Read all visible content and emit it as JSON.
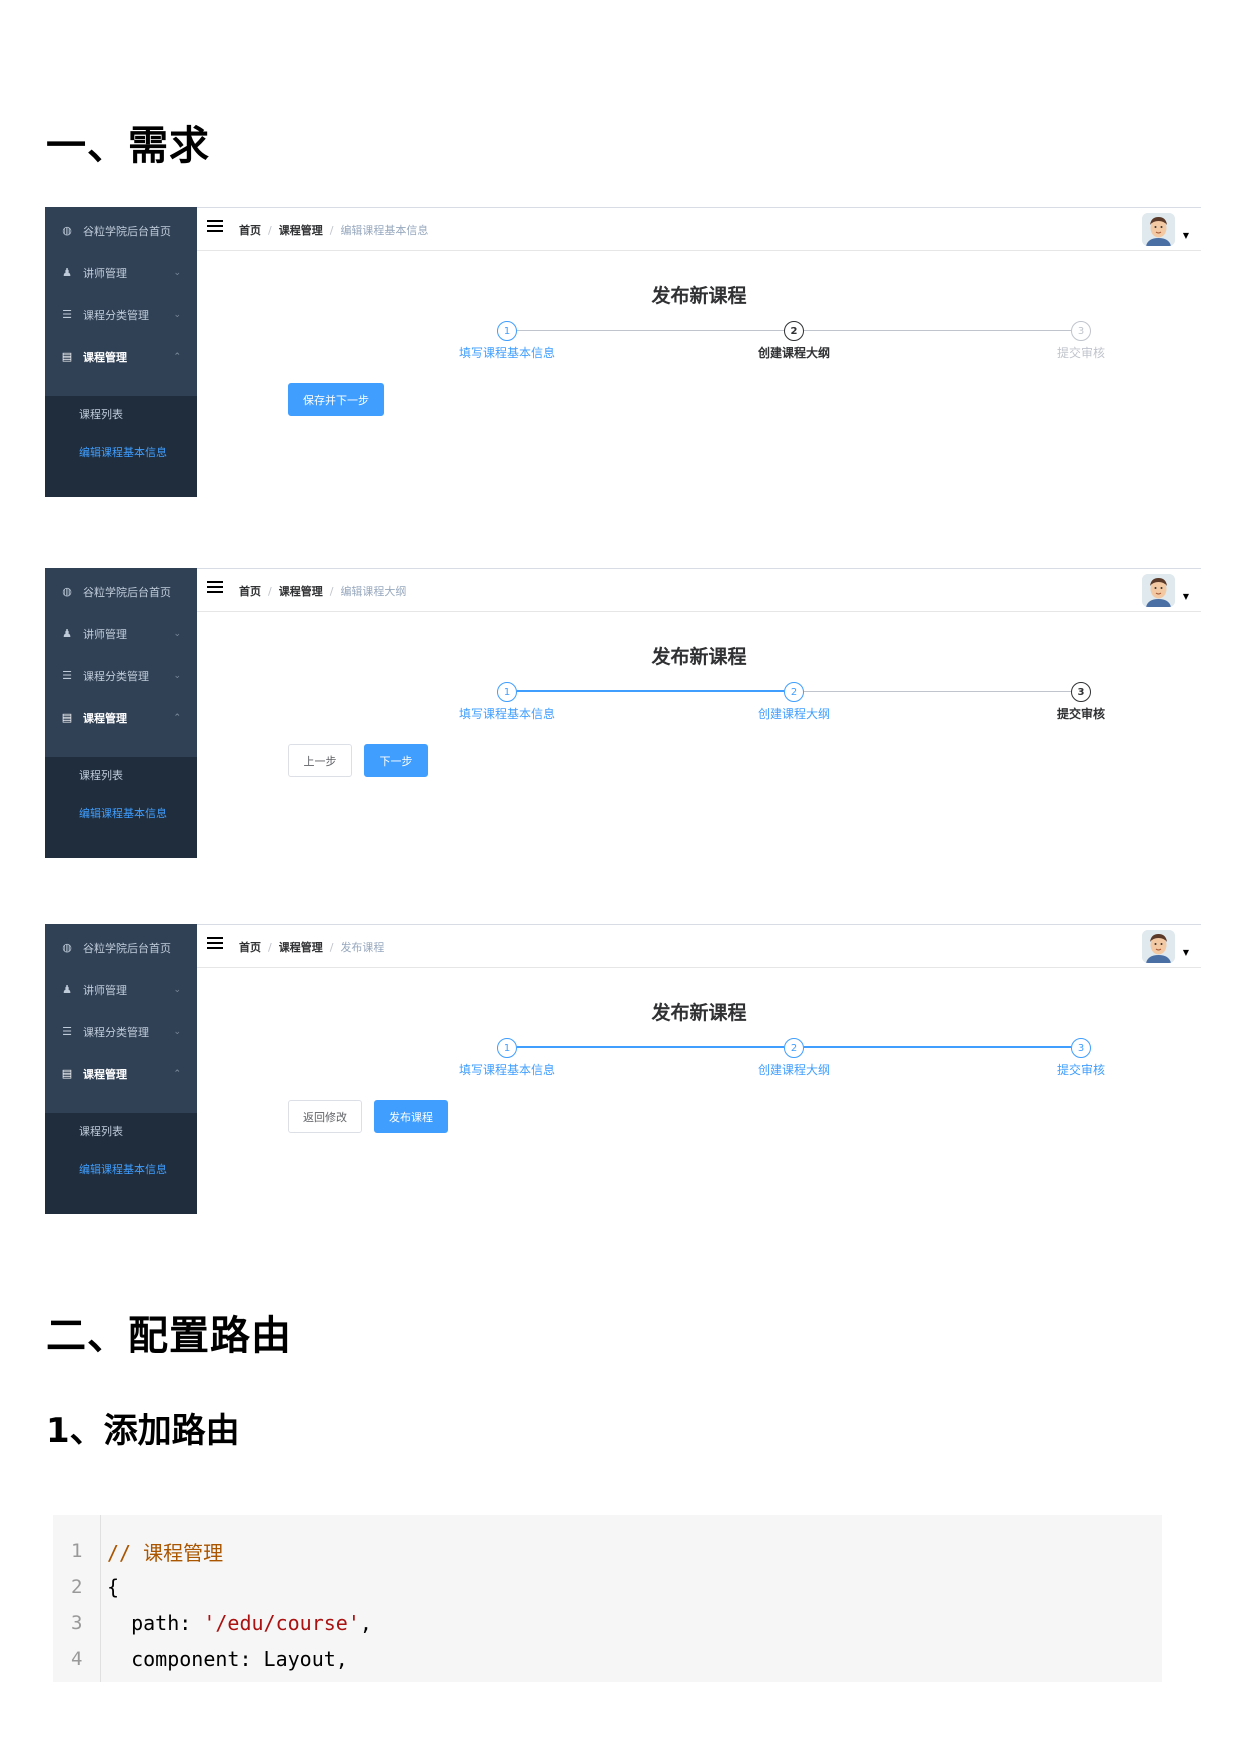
{
  "section1_heading": "一、需求",
  "section2_heading": "二、配置路由",
  "section3_heading": "1、添加路由",
  "sidebar": {
    "items": [
      {
        "label": "谷粒学院后台首页",
        "icon": "dashboard-icon",
        "arrow": ""
      },
      {
        "label": "讲师管理",
        "icon": "user-icon",
        "arrow": "⌄"
      },
      {
        "label": "课程分类管理",
        "icon": "list-icon",
        "arrow": "⌄"
      },
      {
        "label": "课程管理",
        "icon": "form-icon",
        "arrow": "⌃"
      }
    ],
    "sub_items": [
      "课程列表",
      "编辑课程基本信息"
    ]
  },
  "screens": [
    {
      "breadcrumb": [
        "首页",
        "课程管理",
        "编辑课程基本信息"
      ],
      "title": "发布新课程",
      "steps": [
        {
          "num": "1",
          "label": "填写课程基本信息",
          "state": "done"
        },
        {
          "num": "2",
          "label": "创建课程大纲",
          "state": "process"
        },
        {
          "num": "3",
          "label": "提交审核",
          "state": "wait"
        }
      ],
      "buttons": [
        {
          "label": "保存并下一步",
          "type": "primary"
        }
      ]
    },
    {
      "breadcrumb": [
        "首页",
        "课程管理",
        "编辑课程大纲"
      ],
      "title": "发布新课程",
      "steps": [
        {
          "num": "1",
          "label": "填写课程基本信息",
          "state": "done"
        },
        {
          "num": "2",
          "label": "创建课程大纲",
          "state": "done"
        },
        {
          "num": "3",
          "label": "提交审核",
          "state": "process"
        }
      ],
      "buttons": [
        {
          "label": "上一步",
          "type": "default"
        },
        {
          "label": "下一步",
          "type": "primary"
        }
      ]
    },
    {
      "breadcrumb": [
        "首页",
        "课程管理",
        "发布课程"
      ],
      "title": "发布新课程",
      "steps": [
        {
          "num": "1",
          "label": "填写课程基本信息",
          "state": "done"
        },
        {
          "num": "2",
          "label": "创建课程大纲",
          "state": "done"
        },
        {
          "num": "3",
          "label": "提交审核",
          "state": "done"
        }
      ],
      "buttons": [
        {
          "label": "返回修改",
          "type": "default"
        },
        {
          "label": "发布课程",
          "type": "primary"
        }
      ]
    }
  ],
  "code": {
    "lines": [
      {
        "num": "1",
        "parts": [
          {
            "t": "// 课程管理",
            "c": "comment"
          }
        ]
      },
      {
        "num": "2",
        "parts": [
          {
            "t": "{",
            "c": ""
          }
        ]
      },
      {
        "num": "3",
        "parts": [
          {
            "t": "  path: ",
            "c": ""
          },
          {
            "t": "'/edu/course'",
            "c": "string"
          },
          {
            "t": ",",
            "c": ""
          }
        ]
      },
      {
        "num": "4",
        "parts": [
          {
            "t": "  component: Layout,",
            "c": ""
          }
        ]
      }
    ]
  },
  "colors": {
    "accent": "#409eff",
    "sidebar": "#304156",
    "submenu": "#1f2d3d"
  }
}
